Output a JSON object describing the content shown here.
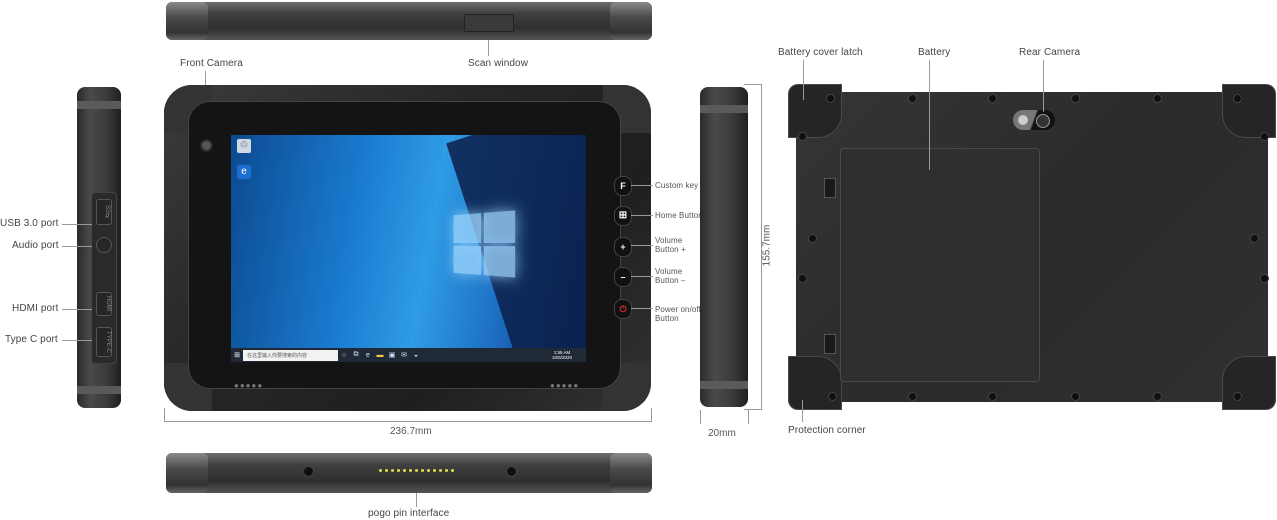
{
  "labels": {
    "scan_window": "Scan window",
    "front_camera": "Front Camera",
    "usb_port": "USB 3.0 port",
    "audio_port": "Audio port",
    "hdmi_port": "HDMI port",
    "typec_port": "Type C port",
    "custom_key": "Custom key",
    "home_button": "Home Button",
    "volume_up": "Volume\nButton +",
    "volume_up_l1": "Volume",
    "volume_up_l2": "Button +",
    "volume_down_l1": "Volume",
    "volume_down_l2": "Button –",
    "power_l1": "Power on/off",
    "power_l2": "Button",
    "battery_cover_latch": "Battery cover latch",
    "battery": "Battery",
    "rear_camera": "Rear Camera",
    "protection_corner": "Protection corner",
    "pogo_pin": "pogo pin interface"
  },
  "dimensions": {
    "width": "236.7mm",
    "height": "155.7mm",
    "depth": "20mm"
  },
  "buttons": {
    "custom": "F",
    "home": "⊞",
    "vol_up": "+",
    "vol_down": "–",
    "power": "⏻"
  },
  "side_ports": {
    "usb": "SS⇆",
    "hdmi": "HDMI",
    "typec": "TYPE-C"
  },
  "screen": {
    "search_placeholder": "在这里输入你要搜索的内容",
    "clock_time": "1:55 AM",
    "clock_date": "10/5/2020",
    "start_icon": "⊞",
    "desktop_icons": [
      "recycle-bin",
      "edge"
    ]
  },
  "colors": {
    "accent_pogo": "#e6d94a",
    "device_body": "#2c2c2c",
    "screen_blue": "#1a7bd0"
  }
}
